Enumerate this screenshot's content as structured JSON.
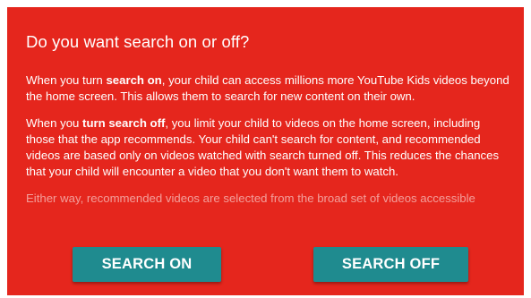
{
  "dialog": {
    "title": "Do you want search on or off?",
    "p1": {
      "a": "When you turn ",
      "b": "search on",
      "c": ", your child can access millions more YouTube Kids videos beyond the home screen. This allows them to search for new content on their own."
    },
    "p2": {
      "a": "When you ",
      "b": "turn search off",
      "c": ", you limit your child to videos on the home screen, including those that the app recommends. Your child can't search for content, and recommended videos are based only on videos watched with search turned off. This reduces the chances that your child will encounter a video that you don't want them to watch."
    },
    "p3": "Either way, recommended videos are selected from the broad set of videos accessible",
    "buttons": {
      "on": "SEARCH ON",
      "off": "SEARCH OFF"
    }
  },
  "colors": {
    "background": "#e5261d",
    "button": "#1f8b8f",
    "text": "#ffffff"
  }
}
